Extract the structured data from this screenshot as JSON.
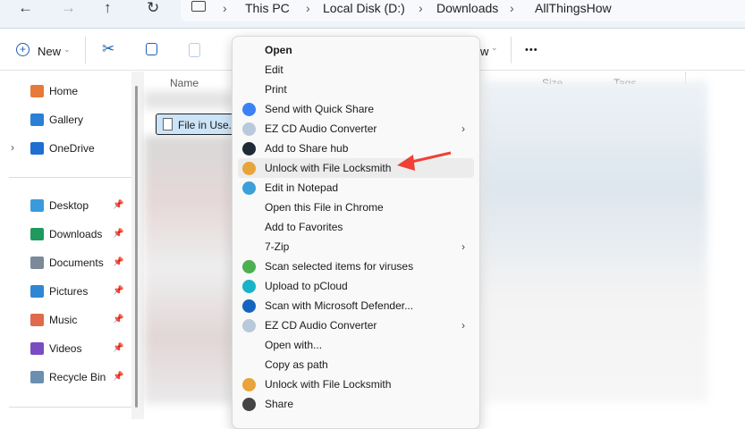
{
  "nav": {
    "back": "←",
    "forward": "→",
    "up": "↑",
    "refresh": "↻"
  },
  "breadcrumb": [
    "This PC",
    "Local Disk (D:)",
    "Downloads",
    "AllThingsHow"
  ],
  "toolbar": {
    "new_label": "New",
    "view_partial": "w",
    "more": "•••"
  },
  "columns": {
    "name": "Name",
    "size": "Size",
    "tags": "Tags"
  },
  "selected_file": "File in Use.t",
  "sidebar": {
    "top": [
      {
        "label": "Home",
        "color": "#e8793a"
      },
      {
        "label": "Gallery",
        "color": "#2b7fd6"
      },
      {
        "label": "OneDrive",
        "color": "#1e6fd1"
      }
    ],
    "pinned": [
      {
        "label": "Desktop",
        "color": "#3a9bdc"
      },
      {
        "label": "Downloads",
        "color": "#1f9a5c"
      },
      {
        "label": "Documents",
        "color": "#7a8a99"
      },
      {
        "label": "Pictures",
        "color": "#2f86d4"
      },
      {
        "label": "Music",
        "color": "#e06a4b"
      },
      {
        "label": "Videos",
        "color": "#7a4cc2"
      },
      {
        "label": "Recycle Bin",
        "color": "#6b8fb0"
      }
    ]
  },
  "menu": [
    {
      "label": "Open",
      "bold": true
    },
    {
      "label": "Edit"
    },
    {
      "label": "Print"
    },
    {
      "label": "Send with Quick Share",
      "icon": "#3b82f6"
    },
    {
      "label": "EZ CD Audio Converter",
      "icon": "#b8c9db",
      "sub": true
    },
    {
      "label": "Add to Share hub",
      "icon": "#1f2937"
    },
    {
      "label": "Unlock with File Locksmith",
      "icon": "#e8a33a",
      "highlight": true
    },
    {
      "label": "Edit in Notepad",
      "icon": "#3ba0d9"
    },
    {
      "label": "Open this File in Chrome"
    },
    {
      "label": "Add to Favorites"
    },
    {
      "label": "7-Zip",
      "sub": true
    },
    {
      "label": "Scan selected items for viruses",
      "icon": "#4caf50"
    },
    {
      "label": "Upload to pCloud",
      "icon": "#17b3c9"
    },
    {
      "label": "Scan with Microsoft Defender...",
      "icon": "#1565c0"
    },
    {
      "label": "EZ CD Audio Converter",
      "icon": "#b8c9db",
      "sub": true
    },
    {
      "label": "Open with..."
    },
    {
      "label": "Copy as path"
    },
    {
      "label": "Unlock with File Locksmith",
      "icon": "#e8a33a"
    },
    {
      "label": "Share",
      "icon": "#444444"
    }
  ],
  "annotation_color": "#ef4136"
}
